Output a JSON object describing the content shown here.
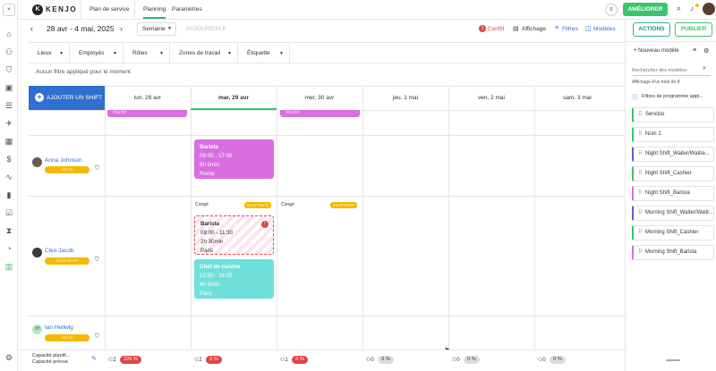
{
  "app": {
    "brand": "KENJO"
  },
  "topbar": {
    "tabs": [
      "Plan de service",
      "Planning",
      "Paramètres"
    ],
    "notification_count": "0",
    "upgrade_label": "AMÉLIORER"
  },
  "toolbar": {
    "date_range": "28 avr - 4 mai, 2025",
    "view_select": "Semaine",
    "today_label": "AUJOURD'HUI",
    "conflict_count": "1",
    "conflict_label": "Conflit",
    "display_label": "Affichage",
    "filters_label": "Filtres",
    "models_label": "Modèles",
    "actions_label": "ACTIONS",
    "publish_label": "PUBLIER"
  },
  "filters": {
    "items": [
      "Lieux",
      "Employés",
      "Rôles",
      "Zones de travail",
      "Étiquette"
    ],
    "none_applied": "Aucun filtre appliqué pour le moment"
  },
  "grid": {
    "add_shift_label": "AJOUTER UN SHIFT",
    "days": [
      "lun, 28 avr",
      "mar, 29 avr",
      "mer, 30 avr",
      "jeu, 1 mai",
      "ven, 2 mai",
      "sam, 3 mai"
    ]
  },
  "employees": [
    {
      "name": "Anna Johnson",
      "badge": "INVITÉ"
    },
    {
      "name": "Cleo Jacob",
      "badge": "EN ATTENTE"
    },
    {
      "name": "Ian Hellwig",
      "badge": "INVITÉ",
      "initials": "JH"
    }
  ],
  "shifts": {
    "anna_tue": {
      "role": "Barista",
      "time": "09:00 - 17:00",
      "duration": "8h 0min",
      "location": "Roma"
    },
    "cleo_tue_1": {
      "role": "Barista",
      "time": "09:00 - 11:30",
      "duration": "2h 30min",
      "location": "Paris"
    },
    "cleo_tue_2": {
      "role": "Chef de cuisine",
      "time": "12:00 - 16:00",
      "duration": "4h 0min",
      "location": "Paris"
    },
    "top_partial_label": "Madrid"
  },
  "leave": {
    "label": "Congé",
    "status": "EN ATTENTE"
  },
  "footer": {
    "capacity_planned": "Capacité planifi...",
    "capacity_expected": "Capacité prévue",
    "counts": [
      "2",
      "2",
      "1",
      "0",
      "0",
      "0"
    ],
    "pcts": [
      "225 %",
      "0 %",
      "0 %",
      "0 %",
      "0 %",
      "0 %"
    ]
  },
  "right_panel": {
    "new_model": "Nouveau modèle",
    "search_placeholder": "Rechercher des modèles",
    "total": "Affichage d'un total de 8",
    "program_filters": "Filtres de programme appl...",
    "models": [
      {
        "name": "Servizio",
        "color": "#3cc36d"
      },
      {
        "name": "Nom 1",
        "color": "#3cc36d"
      },
      {
        "name": "Night Shift_Waiter/Waitre...",
        "color": "#6a5acd"
      },
      {
        "name": "Night Shift_Cashier",
        "color": "#3cc36d"
      },
      {
        "name": "Night Shift_Barista",
        "color": "#d86ee0"
      },
      {
        "name": "Morning Shift_Waiter/Waitr...",
        "color": "#6a5acd"
      },
      {
        "name": "Morning Shift_Cashier",
        "color": "#3cc36d"
      },
      {
        "name": "Morning Shift_Barista",
        "color": "#d86ee0"
      }
    ]
  },
  "colors": {
    "accent": "#3cc36d",
    "barista": "#d86ee0",
    "chef": "#6fe0da",
    "primary": "#2f6fd0",
    "danger": "#e04545",
    "pending": "#f5b800"
  }
}
